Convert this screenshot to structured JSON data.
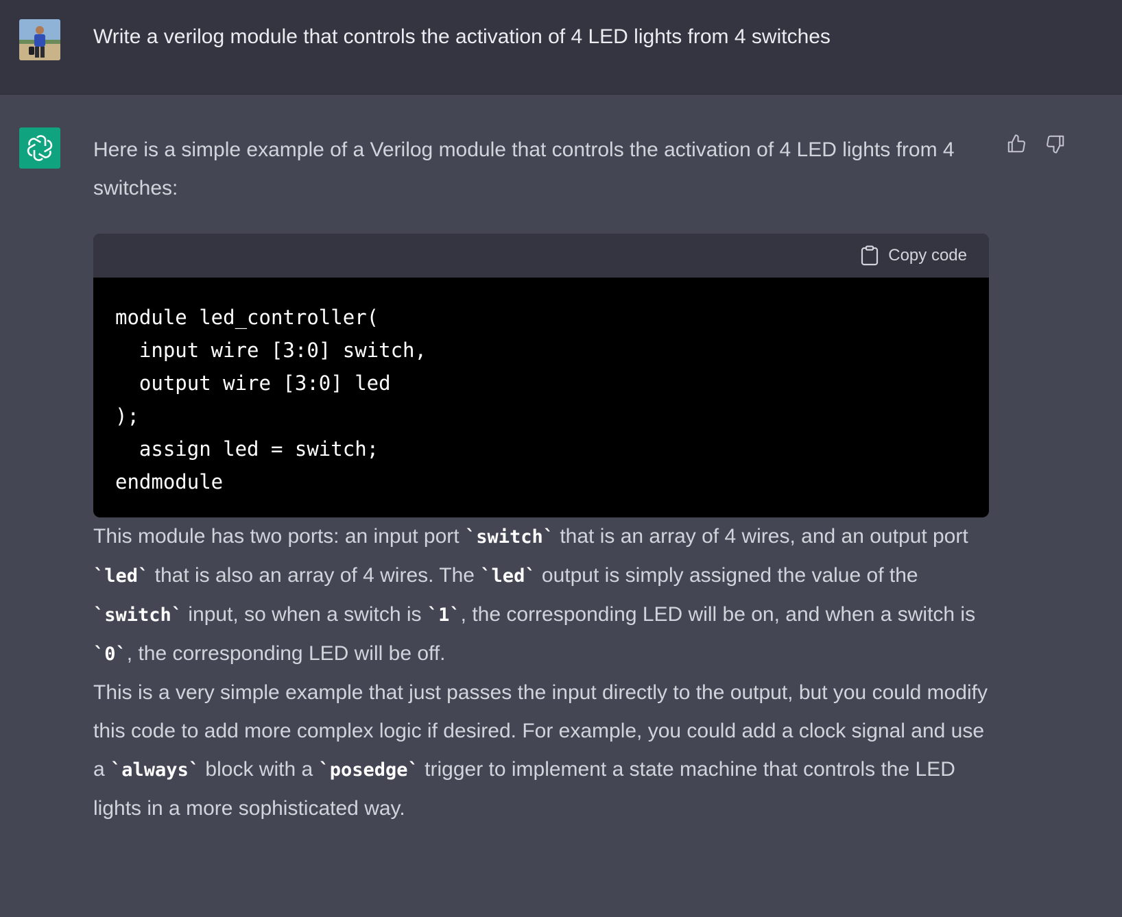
{
  "user_message": {
    "avatar": "user-photo-avatar",
    "text": "Write a verilog module that controls the activation of 4 LED lights from 4 switches"
  },
  "assistant_message": {
    "avatar": "openai-logo-icon",
    "feedback": {
      "thumbs_up_icon": "thumbs-up-icon",
      "thumbs_down_icon": "thumbs-down-icon"
    },
    "intro": "Here is a simple example of a Verilog module that controls the activation of 4 LED lights from 4 switches:",
    "code_block": {
      "copy_label": "Copy code",
      "copy_icon": "clipboard-icon",
      "lines": [
        "module led_controller(",
        "  input wire [3:0] switch,",
        "  output wire [3:0] led",
        ");",
        "  assign led = switch;",
        "endmodule"
      ]
    },
    "explanation": {
      "t1": "This module has two ports: an input port ",
      "c1": "`switch`",
      "t2": " that is an array of 4 wires, and an output port ",
      "c2": "`led`",
      "t3": " that is also an array of 4 wires. The ",
      "c3": "`led`",
      "t4": " output is simply assigned the value of the ",
      "c4": "`switch`",
      "t5": " input, so when a switch is ",
      "c5": "`1`",
      "t6": ", the corresponding LED will be on, and when a switch is ",
      "c6": "`0`",
      "t7": ", the corresponding LED will be off."
    },
    "extra": {
      "t1": "This is a very simple example that just passes the input directly to the output, but you could modify this code to add more complex logic if desired. For example, you could add a clock signal and use a ",
      "c1": "`always`",
      "t2": " block with a ",
      "c2": "`posedge`",
      "t3": " trigger to implement a state machine that controls the LED lights in a more sophisticated way."
    }
  }
}
